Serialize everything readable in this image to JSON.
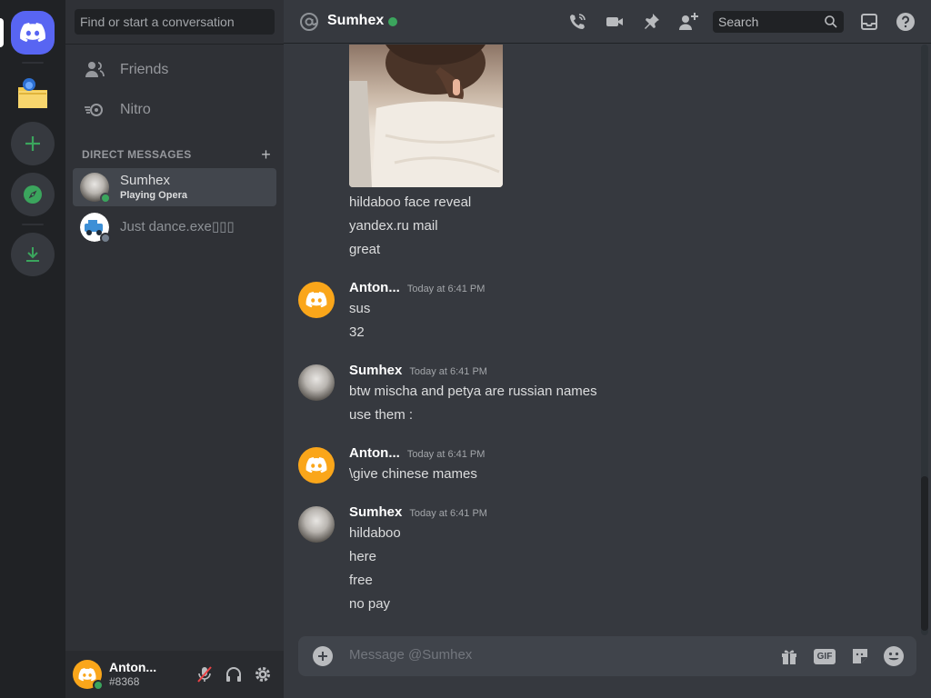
{
  "rail": {
    "items": [
      {
        "name": "home",
        "icon": "discord-logo-icon"
      },
      {
        "name": "folder-server",
        "icon": "folder-icon"
      },
      {
        "name": "add-server",
        "icon": "plus-icon"
      },
      {
        "name": "explore",
        "icon": "compass-icon"
      },
      {
        "name": "download",
        "icon": "download-icon"
      }
    ],
    "colors": {
      "brand": "#5865f2",
      "green": "#3ba55d"
    }
  },
  "sidebar": {
    "search_placeholder": "Find or start a conversation",
    "nav": [
      {
        "label": "Friends",
        "icon": "friends-icon"
      },
      {
        "label": "Nitro",
        "icon": "nitro-icon"
      }
    ],
    "dm_header": "DIRECT MESSAGES",
    "dm_add": "+",
    "dms": [
      {
        "name": "Sumhex",
        "activity": "Playing Opera",
        "status": "online",
        "active": true
      },
      {
        "name": "Just dance.exe▯▯▯",
        "activity": "",
        "status": "offline",
        "active": false
      }
    ]
  },
  "user_panel": {
    "name": "Anton...",
    "tag": "#8368",
    "status_color": "#3ba55d"
  },
  "header": {
    "channel_name": "Sumhex",
    "status_color": "#3ba55d",
    "search_placeholder": "Search",
    "icons": [
      "voice-call-icon",
      "video-call-icon",
      "pin-icon",
      "add-friend-icon",
      "inbox-icon",
      "help-icon"
    ]
  },
  "messages": {
    "continuation_lines": [
      "hildaboo face reveal",
      "yandex.ru mail",
      "great"
    ],
    "groups": [
      {
        "author": "Anton...",
        "time": "Today at 6:41 PM",
        "avatar": "discord-default-orange",
        "lines": [
          "sus",
          "32"
        ]
      },
      {
        "author": "Sumhex",
        "time": "Today at 6:41 PM",
        "avatar": "cat-photo",
        "lines": [
          "btw mischa and petya are russian names",
          "use them :"
        ]
      },
      {
        "author": "Anton...",
        "time": "Today at 6:41 PM",
        "avatar": "discord-default-orange",
        "lines": [
          "\\give chinese mames"
        ]
      },
      {
        "author": "Sumhex",
        "time": "Today at 6:41 PM",
        "avatar": "cat-photo",
        "lines": [
          "hildaboo",
          "here",
          "free",
          "no pay"
        ]
      }
    ]
  },
  "composer": {
    "placeholder": "Message @Sumhex",
    "gif_label": "GIF",
    "icons": [
      "gift-icon",
      "gif-icon",
      "sticker-icon",
      "emoji-icon"
    ]
  }
}
